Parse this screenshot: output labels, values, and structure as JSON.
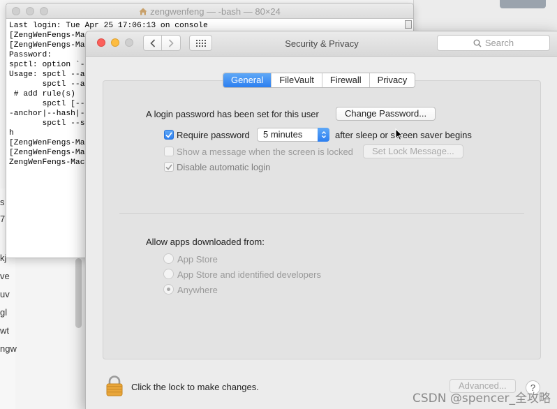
{
  "background_app": {
    "sidebar_fragments": [
      "s",
      "7.",
      "kj",
      "ve",
      "uv",
      "gl",
      "wt",
      "ngw"
    ]
  },
  "terminal": {
    "title": "zengwenfeng — -bash — 80×24",
    "lines": [
      "Last login: Tue Apr 25 17:06:13 on console",
      "[ZengWenFengs-Mac",
      "[ZengWenFengs-Mac",
      "Password:",
      "spctl: option `-",
      "Usage: spctl --a",
      "       spctl --a",
      " # add rule(s)",
      "       spctl [--",
      "-anchor|--hash|-",
      "       spctl --s",
      "h",
      "[ZengWenFengs-Mac",
      "[ZengWenFengs-Mac",
      "ZengWenFengs-Mac"
    ]
  },
  "window": {
    "title": "Security & Privacy",
    "search_placeholder": "Search"
  },
  "tabs": [
    {
      "label": "General",
      "active": true
    },
    {
      "label": "FileVault",
      "active": false
    },
    {
      "label": "Firewall",
      "active": false
    },
    {
      "label": "Privacy",
      "active": false
    }
  ],
  "general": {
    "login_password_text": "A login password has been set for this user",
    "change_password_label": "Change Password...",
    "require_password_label": "Require password",
    "require_password_checked": true,
    "require_password_delay": "5 minutes",
    "after_sleep_text": "after sleep or screen saver begins",
    "show_message_label": "Show a message when the screen is locked",
    "show_message_checked": false,
    "set_lock_message_label": "Set Lock Message...",
    "disable_auto_login_label": "Disable automatic login",
    "disable_auto_login_checked": true,
    "allow_apps_heading": "Allow apps downloaded from:",
    "allow_options": [
      {
        "label": "App Store",
        "selected": false
      },
      {
        "label": "App Store and identified developers",
        "selected": false
      },
      {
        "label": "Anywhere",
        "selected": true
      }
    ]
  },
  "footer": {
    "lock_text": "Click the lock to make changes.",
    "advanced_label": "Advanced...",
    "help_label": "?"
  },
  "watermark": "CSDN @spencer_全攻略",
  "icons": {
    "back": "chevron-left-icon",
    "forward": "chevron-right-icon",
    "grid": "grid-icon",
    "search": "search-icon",
    "lock": "lock-icon",
    "home": "home-icon"
  },
  "colors": {
    "accent": "#2c7ff0",
    "close_light": "#fc605b",
    "minimize_light": "#fdbc40"
  }
}
